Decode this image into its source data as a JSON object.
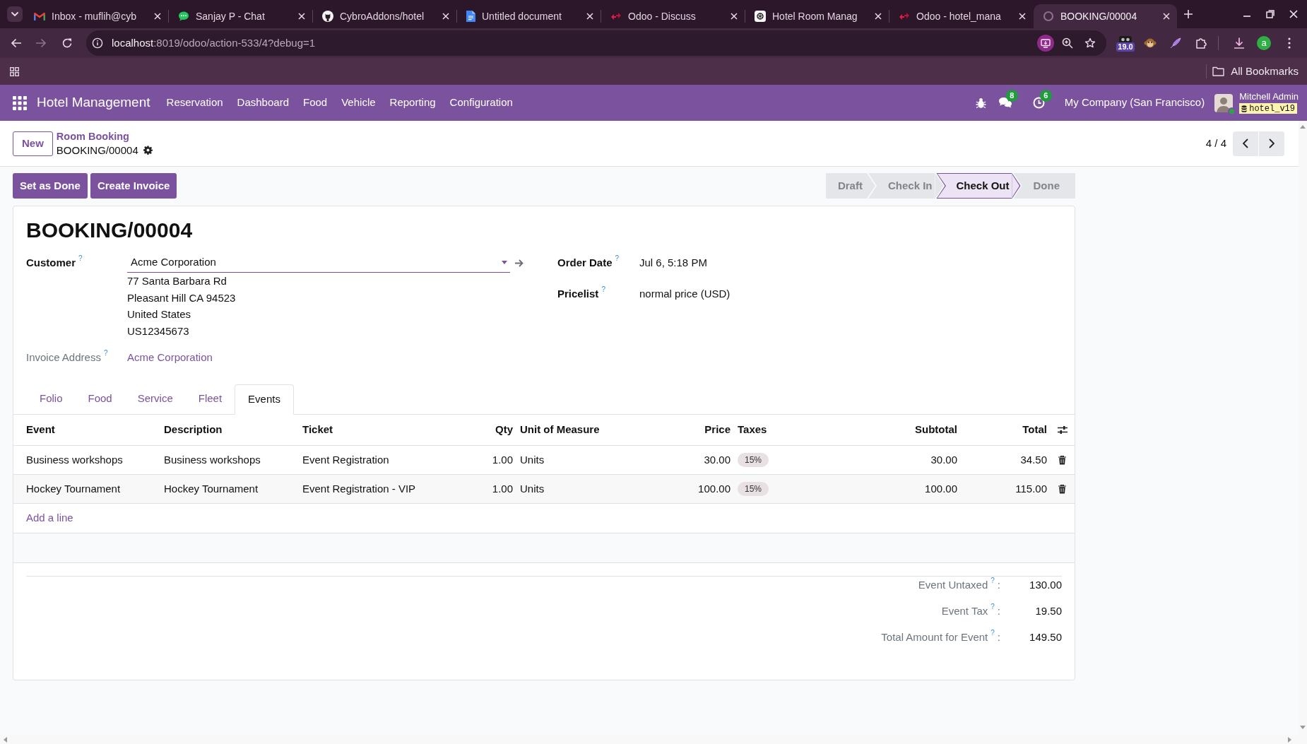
{
  "browser": {
    "tabs": [
      {
        "kind": "mail",
        "title": "Inbox - muflih@cyb",
        "selected": false
      },
      {
        "kind": "chat",
        "title": "Sanjay P - Chat",
        "selected": false
      },
      {
        "kind": "code",
        "title": "CybroAddons/hotel",
        "selected": false
      },
      {
        "kind": "doc",
        "title": "Untitled document",
        "selected": false
      },
      {
        "kind": "odoo",
        "title": "Odoo - Discuss",
        "selected": false
      },
      {
        "kind": "ai",
        "title": "Hotel Room Manag",
        "selected": false
      },
      {
        "kind": "odoo",
        "title": "Odoo - hotel_mana",
        "selected": false
      },
      {
        "kind": "loading",
        "title": "BOOKING/00004",
        "selected": true
      }
    ],
    "forward_disabled": true,
    "url": {
      "host": "localhost",
      "path": ":8019/odoo/action-533/4?debug=1"
    },
    "extension_badge": "19.0",
    "profile_initial": "a",
    "bookmarks_label": "All Bookmarks"
  },
  "navbar": {
    "app_name": "Hotel Management",
    "menu": [
      "Reservation",
      "Dashboard",
      "Food",
      "Vehicle",
      "Reporting",
      "Configuration"
    ],
    "messages_count": "8",
    "activities_count": "6",
    "company": "My Company (San Francisco)",
    "user_name": "Mitchell Admin",
    "database": "hotel_v19"
  },
  "control_panel": {
    "new_button": "New",
    "breadcrumb": "Room Booking",
    "record": "BOOKING/00004",
    "pager": "4 / 4"
  },
  "actions": [
    "Set as Done",
    "Create Invoice"
  ],
  "status_bar": [
    {
      "label": "Draft",
      "selected": false
    },
    {
      "label": "Check In",
      "selected": false
    },
    {
      "label": "Check Out",
      "selected": true
    },
    {
      "label": "Done",
      "selected": false
    }
  ],
  "form": {
    "title": "BOOKING/00004",
    "customer": {
      "label": "Customer",
      "help": "?",
      "value": "Acme Corporation",
      "address": [
        "77 Santa Barbara Rd",
        "Pleasant Hill CA 94523",
        "United States",
        "US12345673"
      ]
    },
    "invoice_address": {
      "label": "Invoice Address",
      "help": "?",
      "value": "Acme Corporation"
    },
    "order_date": {
      "label": "Order Date",
      "help": "?",
      "value": "Jul 6, 5:18 PM"
    },
    "pricelist": {
      "label": "Pricelist",
      "help": "?",
      "value": "normal price (USD)"
    },
    "tabs": [
      {
        "label": "Folio",
        "selected": false
      },
      {
        "label": "Food",
        "selected": false
      },
      {
        "label": "Service",
        "selected": false
      },
      {
        "label": "Fleet",
        "selected": false
      },
      {
        "label": "Events",
        "selected": true
      }
    ],
    "table": {
      "columns": [
        {
          "label": "Event",
          "kind": "text"
        },
        {
          "label": "Description",
          "kind": "text"
        },
        {
          "label": "Ticket",
          "kind": "text"
        },
        {
          "label": "Qty",
          "kind": "number"
        },
        {
          "label": "Unit of Measure",
          "kind": "text"
        },
        {
          "label": "Price",
          "kind": "number"
        },
        {
          "label": "Taxes",
          "kind": "tag"
        },
        {
          "label": "Subtotal",
          "kind": "number"
        },
        {
          "label": "Total",
          "kind": "number"
        }
      ],
      "rows": [
        [
          "Business workshops",
          "Business workshops",
          "Event Registration",
          "1.00",
          "Units",
          "30.00",
          "15%",
          "30.00",
          "34.50"
        ],
        [
          "Hockey Tournament",
          "Hockey Tournament",
          "Event Registration - VIP",
          "1.00",
          "Units",
          "100.00",
          "15%",
          "100.00",
          "115.00"
        ]
      ],
      "add_line": "Add a line"
    },
    "totals": [
      {
        "label": "Event Untaxed",
        "help": "?",
        "suffix": ":",
        "value": "130.00"
      },
      {
        "label": "Event Tax",
        "help": "?",
        "suffix": ":",
        "value": "19.50"
      },
      {
        "label": "Total Amount for Event",
        "help": "?",
        "suffix": ":",
        "value": "149.50"
      }
    ]
  }
}
